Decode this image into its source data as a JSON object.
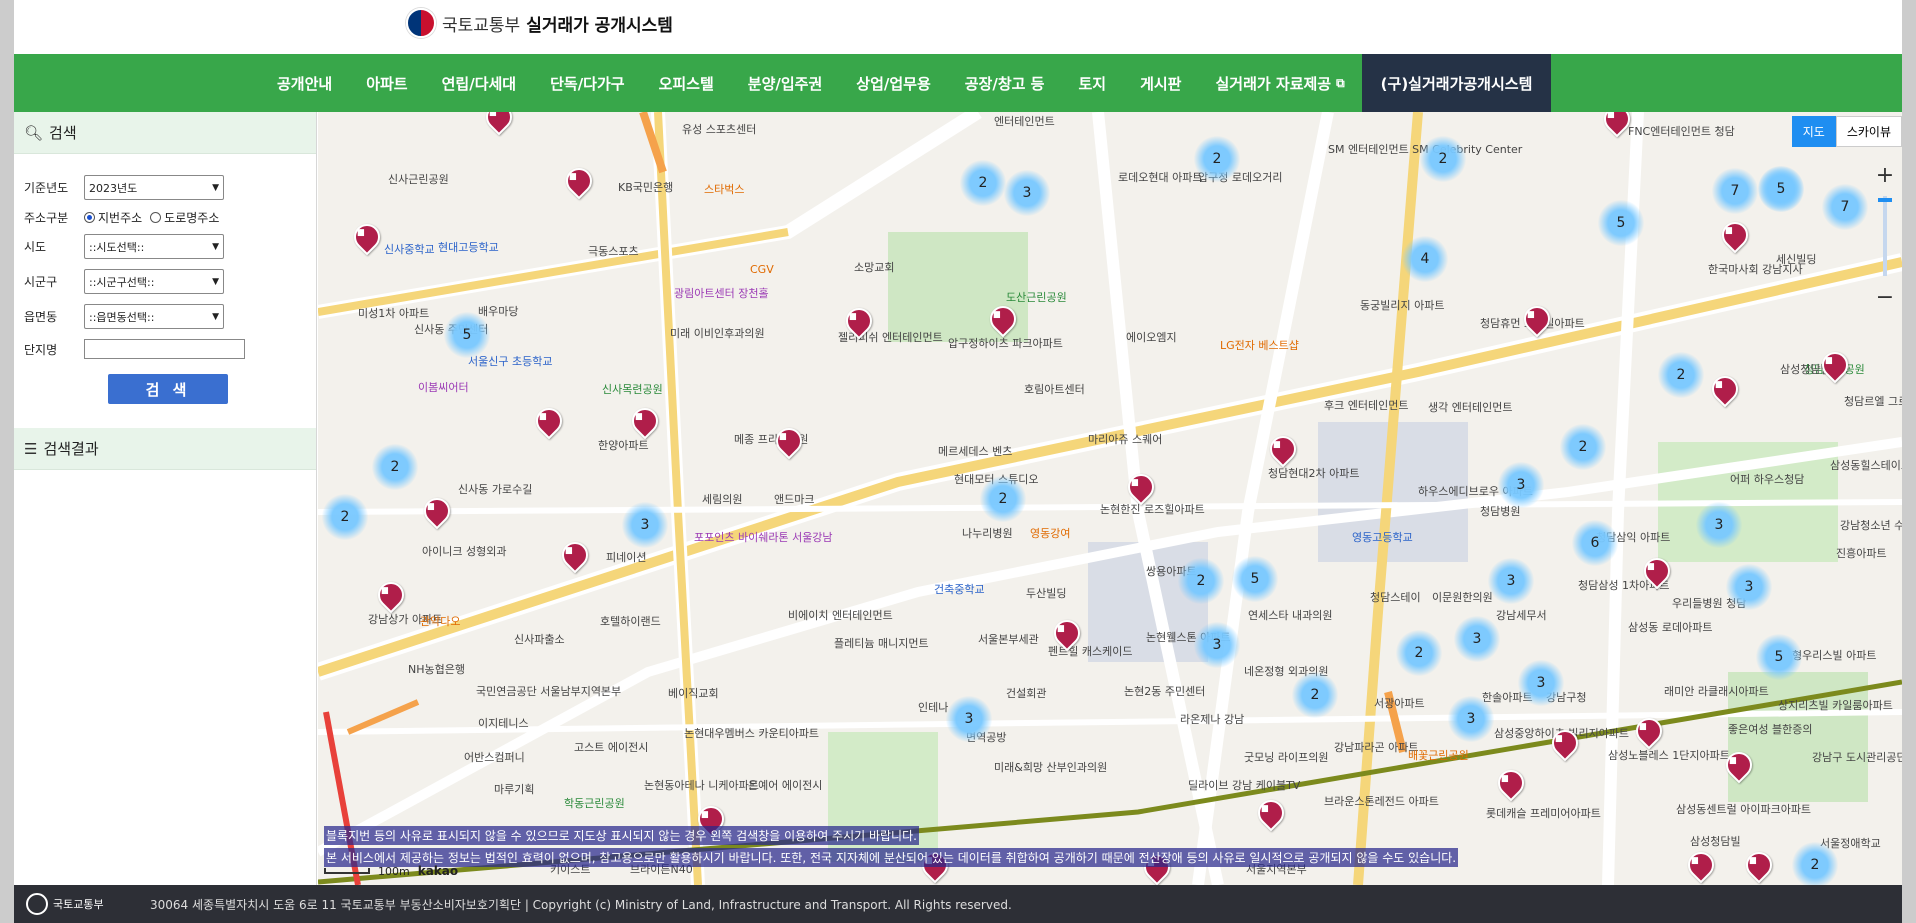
{
  "header": {
    "ministry": "국토교통부",
    "system_name": "실거래가 공개시스템"
  },
  "nav": {
    "items": [
      "공개안내",
      "아파트",
      "연립/다세대",
      "단독/다가구",
      "오피스텔",
      "분양/입주권",
      "상업/업무용",
      "공장/창고 등",
      "토지",
      "게시판",
      "실거래가 자료제공"
    ],
    "legacy": "(구)실거래가공개시스템"
  },
  "sidebar": {
    "search_title": "검색",
    "labels": {
      "year": "기준년도",
      "addr_type": "주소구분",
      "sido": "시도",
      "sigungu": "시군구",
      "eupmyeondong": "읍면동",
      "complex": "단지명"
    },
    "year_value": "2023년도",
    "addr_options": [
      "지번주소",
      "도로명주소"
    ],
    "sido_value": "::시도선택::",
    "sigungu_value": "::시군구선택::",
    "emd_value": "::읍면동선택::",
    "search_button": "검 색",
    "results_title": "검색결과"
  },
  "map": {
    "type_buttons": [
      "지도",
      "스카이뷰"
    ],
    "zoom_in": "+",
    "zoom_out": "−",
    "notice_1": "블록지번 등의 사유로 표시되지 않을 수 있으므로 지도상 표시되지 않는 경우 왼쪽 검색창을 이용하여 주시기 바랍니다.",
    "notice_2": "본 서비스에서 제공하는 정보는 법적인 효력이 없으며, 참고용으로만 활용하시기 바랍니다. 또한, 전국 지자체에 분산되어 있는 데이터를 취합하여 공개하기 때문에 전산장애 등의 사유로 일시적으로 공개되지 않을 수도 있습니다.",
    "scale": "100m",
    "provider": "kakao",
    "clusters": [
      "2",
      "2",
      "3",
      "4",
      "5",
      "7",
      "3",
      "7",
      "5",
      "5",
      "2",
      "2",
      "2",
      "2",
      "2",
      "3",
      "3",
      "6",
      "3",
      "3",
      "2",
      "3",
      "5",
      "2",
      "3",
      "3",
      "3",
      "2",
      "3",
      "2",
      "3",
      "5",
      "2"
    ],
    "places": {
      "p1": "유성 스포츠센터",
      "p2": "엔터테인먼트",
      "p3": "FNC엔터테인먼트 청담",
      "p4": "SM 엔터테인먼트 SM Celebrity Center",
      "p5": "신사근린공원",
      "p6": "KB국민은행",
      "p7": "스타벅스",
      "p8": "로데오현대 아파트",
      "p9": "압구정 로데오거리",
      "p10": "신사중학교",
      "p11": "현대고등학교",
      "p12": "극동스포츠",
      "p13": "CGV",
      "p14": "소망교회",
      "p15": "도산근린공원",
      "p16": "미성1차 아파트",
      "p17": "배우마당",
      "p18": "광림아트센터 장천홀",
      "p19": "미래 이비인후과의원",
      "p20": "젤리피쉬 엔터테인먼트",
      "p21": "압구정하이츠 파크아파트",
      "p22": "에이오엠지",
      "p23": "동궁빌리지 아파트",
      "p24": "청담휴먼 스타빌아파트",
      "p25": "신사동 주민센터",
      "p26": "서울신구 초등학교",
      "p27": "신사목련공원",
      "p28": "이봄씨어터",
      "p29": "호림아트센터",
      "p30": "LG전자 베스트샵",
      "p31": "후크 엔터테인먼트",
      "p32": "생각 엔터테인먼트",
      "p33": "청담근린공원",
      "p34": "한양아파트",
      "p35": "메종 프리베의원",
      "p36": "메르세데스 벤츠",
      "p37": "마리아쥬 스퀘어",
      "p38": "청담현대2차 아파트",
      "p39": "하우스에디브로우 아파트",
      "p40": "청담병원",
      "p41": "어퍼 하우스청담",
      "p42": "강남청소년 수련관",
      "p43": "신사동 가로수길",
      "p44": "세림의원",
      "p45": "앤드마크",
      "p46": "현대모터 스튜디오",
      "p47": "논현한진 로즈힐아파트",
      "p48": "영동고등학교",
      "p49": "청담삼익 아파트",
      "p50": "진흥아파트",
      "p51": "아이니크 성형외과",
      "p52": "피네이션",
      "p53": "포포인츠 바이쉐라톤 서울강남",
      "p54": "나누리병원",
      "p55": "영동강여",
      "p56": "건축중학교",
      "p57": "두산빌딩",
      "p58": "쌍용아파트",
      "p59": "연세스타 내과의원",
      "p60": "청담스테이",
      "p61": "이문원한의원",
      "p62": "청담삼성 1차아파트",
      "p63": "우리들병원 청담",
      "p64": "강남상가 아파트",
      "p65": "관악다오",
      "p66": "신사파출소",
      "p67": "호텔하이랜드",
      "p68": "비에이치 엔터테인먼트",
      "p69": "서울본부세관",
      "p70": "펜트힐 캐스케이드",
      "p71": "논현웰스톤 아파트",
      "p72": "강남세무서",
      "p73": "삼성동 로데아파트",
      "p74": "형우리스빌 아파트",
      "p75": "NH농협은행",
      "p76": "국민연금공단 서울남부지역본부",
      "p77": "베이직교회",
      "p78": "플레티늄 매니지먼트",
      "p79": "건설회관",
      "p80": "논현2동 주민센터",
      "p81": "네온정형 외과의원",
      "p82": "서광아파트",
      "p83": "한솔아파트",
      "p84": "강남구청",
      "p85": "래미안 라클래시아파트",
      "p86": "상지리츠빌 카일룸아파트",
      "p87": "이지테니스",
      "p88": "고스트 에이전시",
      "p89": "논현대우멤버스 카운티아파트",
      "p90": "인테나",
      "p91": "면역공방",
      "p92": "라온제나 강남",
      "p93": "굿모닝 라이프의원",
      "p94": "강남파라곤 아파트",
      "p95": "배꽃근린공원",
      "p96": "삼성중앙하이츠 빌리지아파트",
      "p97": "삼성노블레스 1단지아파트",
      "p98": "좋은여성 블한증의",
      "p99": "강남구 도시관리공단",
      "p100": "어반스컴퍼니",
      "p101": "마루기획",
      "p102": "학동근린공원",
      "p103": "논현동아테나 니케아파트",
      "p104": "온예어 에이전시",
      "p105": "미래&희망 산부인과의원",
      "p106": "딜라이브 강남 케이블TV",
      "p107": "브라운스톤레전드 아파트",
      "p108": "롯데캐슬 프레미어아파트",
      "p109": "삼성동센트럴 아이파크아파트",
      "p110": "서울정애학교",
      "p111": "키이스트",
      "p112": "브라이튼N40",
      "p113": "서울지역본부",
      "p114": "삼성청담빌",
      "p115": "세신빌딩",
      "p116": "한국마사회 강남지사",
      "p117": "삼성청담빌라",
      "p118": "청담르엘 그로브아파트",
      "p119": "삼성동힐스테이트 2단지아파트"
    }
  },
  "footer": {
    "logo_text": "국토교통부",
    "address": "30064 세종특별자치시 도움 6로 11 국토교통부 부동산소비자보호기획단  |  Copyright (c) Ministry of Land, Infrastructure and Transport. All Rights reserved."
  }
}
